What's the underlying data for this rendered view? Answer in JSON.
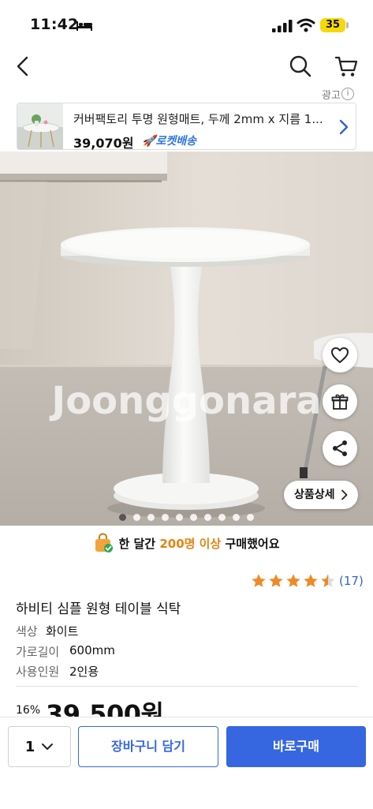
{
  "status_bar": {
    "time": "11:42",
    "battery": "35"
  },
  "ad": {
    "label": "광고",
    "info_symbol": "i",
    "title": "커버팩토리 투명 원형매트, 두께 2mm x 지름 1...",
    "price": "39,070원",
    "badge": "로켓배송"
  },
  "gallery": {
    "watermark": "Joonggonara",
    "detail_button": "상품상세",
    "image_count": 10,
    "active_index": 0
  },
  "purchase_stat": {
    "prefix": "한 달간 ",
    "highlight": "200명 이상",
    "suffix": " 구매했어요"
  },
  "rating": {
    "stars": 4.5,
    "review_count": "(17)"
  },
  "product": {
    "name": "하비티 심플 원형 테이블 식탁",
    "options": [
      {
        "label": "색상",
        "value": "화이트"
      },
      {
        "label": "가로길이",
        "value": "600mm"
      },
      {
        "label": "사용인원",
        "value": "2인용"
      }
    ],
    "discount": "16%",
    "price": "39,500원"
  },
  "bottom_bar": {
    "quantity": "1",
    "cart_label": "장바구니 담기",
    "buy_label": "바로구매"
  },
  "colors": {
    "accent_blue": "#3667e0",
    "star_orange": "#f08a24",
    "battery_yellow": "#f5d90a"
  }
}
